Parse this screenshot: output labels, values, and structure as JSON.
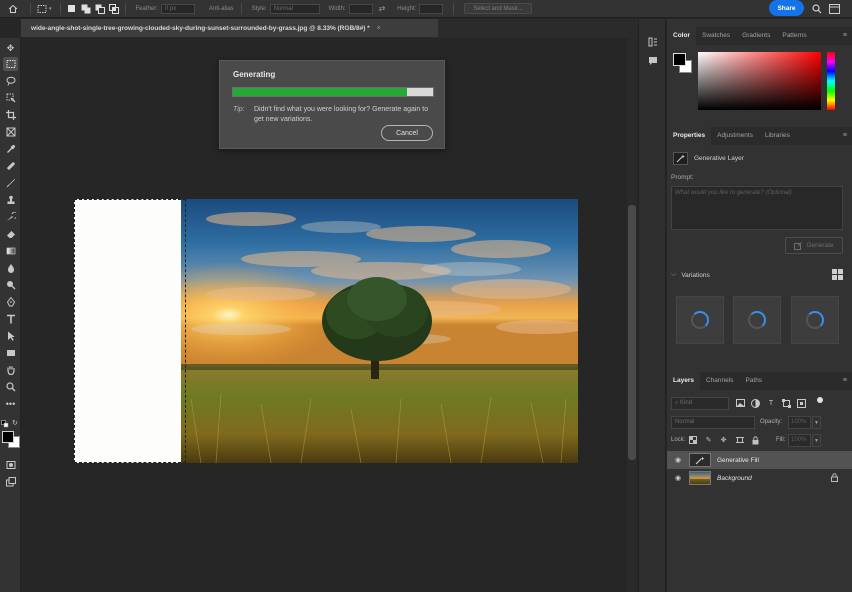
{
  "options_bar": {
    "feather_label": "Feather:",
    "feather_value": "0 px",
    "antialias_label": "Anti-alias",
    "style_label": "Style:",
    "style_value": "Normal",
    "width_label": "Width:",
    "height_label": "Height:",
    "select_mask_label": "Select and Mask...",
    "share_label": "Share"
  },
  "document": {
    "tab_title": "wide-angle-shot-single-tree-growing-clouded-sky-during-sunset-surrounded-by-grass.jpg @ 8.33% (RGB/8#) *",
    "tab_close": "×"
  },
  "dialog": {
    "title": "Generating",
    "progress_percent": 87,
    "tip_label": "Tip:",
    "tip_text": "Didn't find what you were looking for? Generate again to get new variations.",
    "cancel_label": "Cancel"
  },
  "color_panel": {
    "tabs": [
      "Color",
      "Swatches",
      "Gradients",
      "Patterns"
    ],
    "foreground_color": "#000000",
    "background_color": "#ffffff"
  },
  "properties_panel": {
    "tabs": [
      "Properties",
      "Adjustments",
      "Libraries"
    ],
    "layer_type": "Generative Layer",
    "prompt_label": "Prompt:",
    "prompt_placeholder": "What would you like to generate? (Optional)",
    "generate_label": "Generate",
    "variations_label": "Variations"
  },
  "layers_panel": {
    "tabs": [
      "Layers",
      "Channels",
      "Paths"
    ],
    "search_placeholder": "Kind",
    "blend_mode": "Normal",
    "opacity_label": "Opacity:",
    "opacity_value": "100%",
    "lock_label": "Lock:",
    "fill_label": "Fill:",
    "fill_value": "100%",
    "layers": [
      {
        "name": "Generative Fill",
        "selected": true
      },
      {
        "name": "Background",
        "selected": false,
        "locked": true
      }
    ]
  },
  "colors": {
    "accent": "#1473e6",
    "progress": "#25a837",
    "spinner": "#3b8ef0"
  }
}
